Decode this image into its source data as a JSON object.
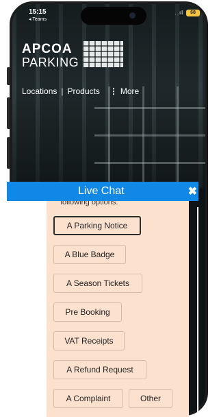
{
  "status_bar": {
    "time": "15:15",
    "back_app": "◂ Teams",
    "signal": "..ıl",
    "battery": "68"
  },
  "brand": {
    "line1": "APCOA",
    "line2": "PARKING"
  },
  "nav": {
    "items": [
      "Locations",
      "Products",
      "More"
    ],
    "separator": "|"
  },
  "live_chat": {
    "title": "Live Chat",
    "close_glyph": "✖",
    "intro_text": "following options:",
    "options": [
      "A Parking Notice",
      "A Blue Badge",
      "A Season Tickets",
      "Pre Booking",
      "VAT Receipts",
      "A Refund Request",
      "A Complaint",
      "Other"
    ],
    "selected_index": 0
  },
  "colors": {
    "chat_header": "#1187e6",
    "chat_panel": "#fde1cf",
    "option_border": "#d7b9a6"
  }
}
